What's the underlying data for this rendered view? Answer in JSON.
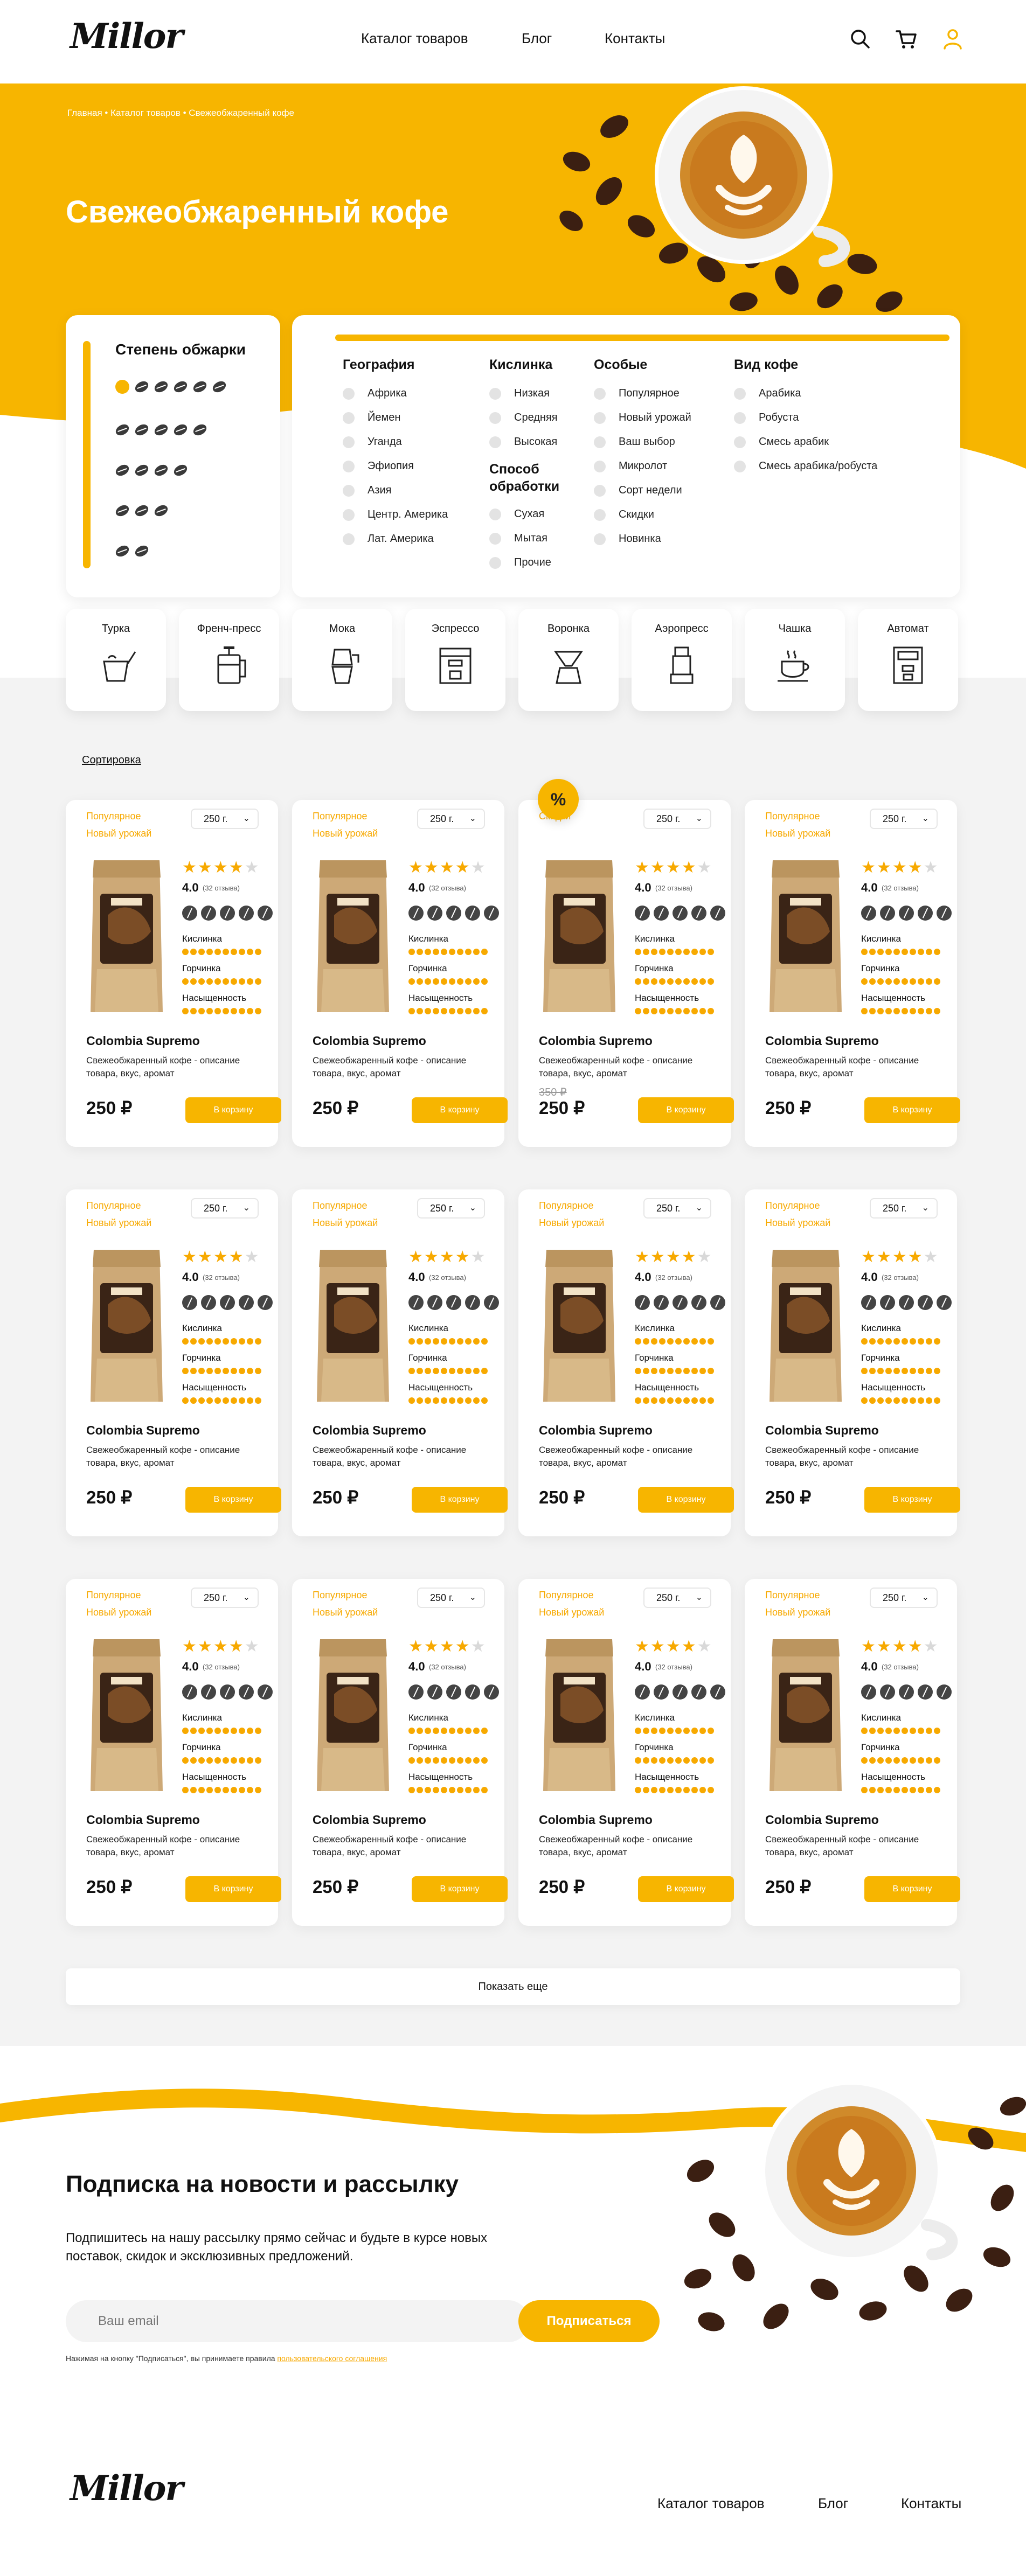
{
  "header": {
    "logo": "Millor",
    "nav": [
      "Каталог товаров",
      "Блог",
      "Контакты"
    ],
    "icons": [
      "search-icon",
      "cart-icon",
      "user-icon"
    ]
  },
  "hero": {
    "breadcrumb": "Главная • Каталог товаров • Свежеобжаренный кофе",
    "title": "Свежеобжаренный кофе"
  },
  "roast": {
    "title": "Степень обжарки",
    "levels": [
      6,
      5,
      4,
      3,
      2
    ]
  },
  "filters": {
    "geography": {
      "title": "География",
      "options": [
        "Африка",
        "Йемен",
        "Уганда",
        "Эфиопия",
        "Азия",
        "Центр. Америка",
        "Лат. Америка"
      ]
    },
    "acidity": {
      "title": "Кислинка",
      "options": [
        "Низкая",
        "Средняя",
        "Высокая"
      ]
    },
    "processing": {
      "title": "Способ обработки",
      "options": [
        "Сухая",
        "Мытая",
        "Прочие"
      ]
    },
    "special": {
      "title": "Особые",
      "options": [
        "Популярное",
        "Новый урожай",
        "Ваш выбор",
        "Микролот",
        "Сорт недели",
        "Скидки",
        "Новинка"
      ]
    },
    "coffee_type": {
      "title": "Вид кофе",
      "options": [
        "Арабика",
        "Робуста",
        "Смесь арабик",
        "Смесь арабика/робуста"
      ]
    }
  },
  "brew_methods": [
    "Турка",
    "Френч-пресс",
    "Мока",
    "Эспрессо",
    "Воронка",
    "Аэропресс",
    "Чашка",
    "Автомат"
  ],
  "sort_label": "Сортировка",
  "sale_badge": "%",
  "product_common": {
    "name": "Colombia Supremo",
    "desc": "Свежеобжаренный кофе - описание товара, вкус, аромат",
    "price": "250 ₽",
    "weight": "250 г.",
    "rating": "4.0",
    "reviews": "(32 отзыва)",
    "stars": 4,
    "buy": "В корзину",
    "attrs": [
      "Кислинка",
      "Горчинка",
      "Насыщенность"
    ]
  },
  "products": [
    {
      "tags": [
        "Популярное",
        "Новый урожай"
      ],
      "old_price": ""
    },
    {
      "tags": [
        "Популярное",
        "Новый урожай"
      ],
      "old_price": ""
    },
    {
      "tags": [
        "Скидки"
      ],
      "old_price": "350 ₽"
    },
    {
      "tags": [
        "Популярное",
        "Новый урожай"
      ],
      "old_price": ""
    },
    {
      "tags": [
        "Популярное",
        "Новый урожай"
      ],
      "old_price": ""
    },
    {
      "tags": [
        "Популярное",
        "Новый урожай"
      ],
      "old_price": ""
    },
    {
      "tags": [
        "Популярное",
        "Новый урожай"
      ],
      "old_price": ""
    },
    {
      "tags": [
        "Популярное",
        "Новый урожай"
      ],
      "old_price": ""
    },
    {
      "tags": [
        "Популярное",
        "Новый урожай"
      ],
      "old_price": ""
    },
    {
      "tags": [
        "Популярное",
        "Новый урожай"
      ],
      "old_price": ""
    },
    {
      "tags": [
        "Популярное",
        "Новый урожай"
      ],
      "old_price": ""
    },
    {
      "tags": [
        "Популярное",
        "Новый урожай"
      ],
      "old_price": ""
    }
  ],
  "show_more": "Показать еще",
  "subscribe": {
    "title": "Подписка на новости и рассылку",
    "text": "Подпишитесь на нашу рассылку прямо сейчас и будьте в курсе новых поставок, скидок и эксклюзивных предложений.",
    "placeholder": "Ваш email",
    "button": "Подписаться",
    "note": "Нажимая на кнопку \"Подписаться\", вы принимаете правила",
    "note_link": "пользовательского соглашения"
  },
  "footer": {
    "logo": "Millor",
    "nav": [
      "Каталог товаров",
      "Блог",
      "Контакты"
    ]
  },
  "colors": {
    "accent": "#f7b500",
    "text": "#111111",
    "bg_gray": "#f3f3f3"
  }
}
